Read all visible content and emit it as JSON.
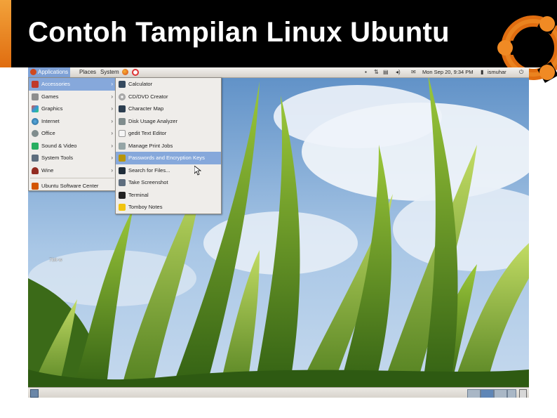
{
  "slide": {
    "title": "Contoh Tampilan Linux Ubuntu",
    "accent_color": "#e8831f",
    "logo_icon": "ubuntu-circle-of-friends-logo"
  },
  "panel": {
    "menus": [
      "Applications",
      "Places",
      "System"
    ],
    "launchers": [
      "firefox-icon",
      "help-icon"
    ],
    "clock": "Mon Sep 20,  9:34 PM",
    "username": "ismuhar",
    "tray_icons": [
      "notification-icon",
      "network-icon",
      "volume-icon",
      "mail-icon",
      "power-icon"
    ]
  },
  "applications_menu": {
    "items": [
      {
        "label": "Accessories",
        "icon": "accessories-icon",
        "has_submenu": true,
        "selected": true
      },
      {
        "label": "Games",
        "icon": "games-icon",
        "has_submenu": true
      },
      {
        "label": "Graphics",
        "icon": "graphics-icon",
        "has_submenu": true
      },
      {
        "label": "Internet",
        "icon": "internet-icon",
        "has_submenu": true
      },
      {
        "label": "Office",
        "icon": "office-icon",
        "has_submenu": true
      },
      {
        "label": "Sound & Video",
        "icon": "sound-video-icon",
        "has_submenu": true
      },
      {
        "label": "System Tools",
        "icon": "system-tools-icon",
        "has_submenu": true
      },
      {
        "label": "Wine",
        "icon": "wine-icon",
        "has_submenu": true
      }
    ],
    "footer_item": {
      "label": "Ubuntu Software Center",
      "icon": "software-center-icon"
    }
  },
  "accessories_menu": {
    "items": [
      {
        "label": "Calculator",
        "icon": "calculator-icon"
      },
      {
        "label": "CD/DVD Creator",
        "icon": "cd-dvd-icon"
      },
      {
        "label": "Character Map",
        "icon": "character-map-icon"
      },
      {
        "label": "Disk Usage Analyzer",
        "icon": "disk-usage-icon"
      },
      {
        "label": "gedit Text Editor",
        "icon": "text-editor-icon"
      },
      {
        "label": "Manage Print Jobs",
        "icon": "printer-icon"
      },
      {
        "label": "Passwords and Encryption Keys",
        "icon": "keys-icon",
        "selected": true
      },
      {
        "label": "Search for Files...",
        "icon": "search-icon"
      },
      {
        "label": "Take Screenshot",
        "icon": "screenshot-icon"
      },
      {
        "label": "Terminal",
        "icon": "terminal-icon"
      },
      {
        "label": "Tomboy Notes",
        "icon": "notes-icon"
      }
    ]
  },
  "desktop": {
    "partial_label": "7bit-w"
  },
  "bottom_panel": {
    "show_desktop_icon": "show-desktop-icon",
    "trash_icon": "trash-icon",
    "workspaces": 4,
    "active_workspace": 2
  }
}
